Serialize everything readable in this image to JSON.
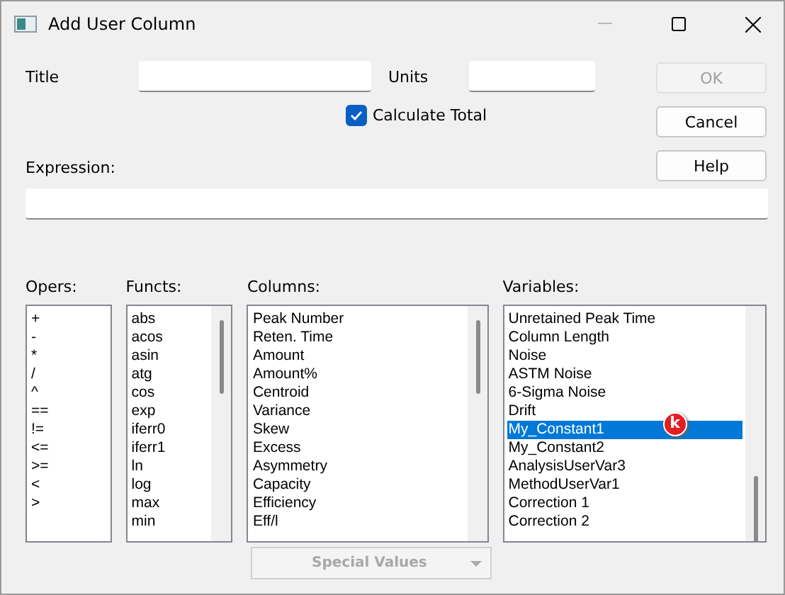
{
  "window": {
    "title": "Add User Column"
  },
  "title_field": {
    "label": "Title"
  },
  "units_field": {
    "label": "Units"
  },
  "calculate_total": {
    "label": "Calculate Total",
    "checked": true
  },
  "buttons": [
    {
      "label": "OK",
      "disabled": true
    },
    {
      "label": "Cancel",
      "disabled": false
    },
    {
      "label": "Help",
      "disabled": false
    }
  ],
  "expression": {
    "label": "Expression:"
  },
  "lists": [
    {
      "label": "Opers:",
      "scrollbar": false,
      "items": [
        {
          "text": "+",
          "selected": false
        },
        {
          "text": "-",
          "selected": false
        },
        {
          "text": "*",
          "selected": false
        },
        {
          "text": "/",
          "selected": false
        },
        {
          "text": "^",
          "selected": false
        },
        {
          "text": "==",
          "selected": false
        },
        {
          "text": "!=",
          "selected": false
        },
        {
          "text": "<=",
          "selected": false
        },
        {
          "text": ">=",
          "selected": false
        },
        {
          "text": "<",
          "selected": false
        },
        {
          "text": ">",
          "selected": false
        }
      ]
    },
    {
      "label": "Functs:",
      "scrollbar": true,
      "items": [
        {
          "text": "abs",
          "selected": false
        },
        {
          "text": "acos",
          "selected": false
        },
        {
          "text": "asin",
          "selected": false
        },
        {
          "text": "atg",
          "selected": false
        },
        {
          "text": "cos",
          "selected": false
        },
        {
          "text": "exp",
          "selected": false
        },
        {
          "text": "iferr0",
          "selected": false
        },
        {
          "text": "iferr1",
          "selected": false
        },
        {
          "text": "ln",
          "selected": false
        },
        {
          "text": "log",
          "selected": false
        },
        {
          "text": "max",
          "selected": false
        },
        {
          "text": "min",
          "selected": false
        }
      ]
    },
    {
      "label": "Columns:",
      "scrollbar": true,
      "items": [
        {
          "text": "Peak Number",
          "selected": false
        },
        {
          "text": "Reten. Time",
          "selected": false
        },
        {
          "text": "Amount",
          "selected": false
        },
        {
          "text": "Amount%",
          "selected": false
        },
        {
          "text": "Centroid",
          "selected": false
        },
        {
          "text": "Variance",
          "selected": false
        },
        {
          "text": "Skew",
          "selected": false
        },
        {
          "text": "Excess",
          "selected": false
        },
        {
          "text": "Asymmetry",
          "selected": false
        },
        {
          "text": "Capacity",
          "selected": false
        },
        {
          "text": "Efficiency",
          "selected": false
        },
        {
          "text": "Eff/l",
          "selected": false
        }
      ]
    },
    {
      "label": "Variables:",
      "scrollbar": true,
      "items": [
        {
          "text": "Unretained Peak Time",
          "selected": false
        },
        {
          "text": "Column Length",
          "selected": false
        },
        {
          "text": "Noise",
          "selected": false
        },
        {
          "text": "ASTM Noise",
          "selected": false
        },
        {
          "text": "6-Sigma Noise",
          "selected": false
        },
        {
          "text": "Drift",
          "selected": false
        },
        {
          "text": "My_Constant1",
          "selected": true,
          "badge": "k"
        },
        {
          "text": "My_Constant2",
          "selected": false
        },
        {
          "text": "AnalysisUserVar3",
          "selected": false
        },
        {
          "text": "MethodUserVar1",
          "selected": false
        },
        {
          "text": "Correction 1",
          "selected": false
        },
        {
          "text": "Correction 2",
          "selected": false
        }
      ]
    }
  ],
  "special_values": {
    "label": "Special Values",
    "disabled": true
  }
}
